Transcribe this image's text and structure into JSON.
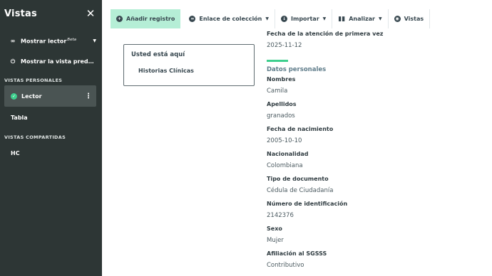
{
  "sidebar": {
    "title": "Vistas",
    "close_icon": "close-icon",
    "actions": [
      {
        "icon": "infinity-icon",
        "label": "Mostrar lector",
        "badge": "Beta"
      },
      {
        "icon": "power-icon",
        "label": "Mostrar la vista predeterminada"
      }
    ],
    "personal_section": "VISTAS PERSONALES",
    "personal_views": [
      {
        "label": "Lector",
        "active": true
      },
      {
        "label": "Tabla"
      }
    ],
    "shared_section": "VISTAS COMPARTIDAS",
    "shared_views": [
      {
        "label": "HC"
      }
    ]
  },
  "toolbar": {
    "add_record": "Añadir registro",
    "collection_link": "Enlace de colección",
    "import": "Importar",
    "analyze": "Analizar",
    "views": "Vistas"
  },
  "breadcrumb": {
    "title": "Usted está aquí",
    "item": "Historias Clínicas"
  },
  "record": {
    "top_field": {
      "label": "Fecha de la atención de primera vez",
      "value": "2025-11-12"
    },
    "section_title": "Datos personales",
    "fields": [
      {
        "label": "Nombres",
        "value": "Camila"
      },
      {
        "label": "Apellidos",
        "value": "granados"
      },
      {
        "label": "Fecha de nacimiento",
        "value": "2005-10-10"
      },
      {
        "label": "Nacionalidad",
        "value": "Colombiana"
      },
      {
        "label": "Tipo de documento",
        "value": "Cédula de Ciudadanía"
      },
      {
        "label": "Número de identificación",
        "value": "2142376"
      },
      {
        "label": "Sexo",
        "value": "Mujer"
      },
      {
        "label": "Afiliación al SGSSS",
        "value": "Contributivo"
      }
    ]
  },
  "colors": {
    "sidebar_bg": "#2d3635",
    "accent_green": "#3ecf8e",
    "primary_button_bg": "#b5eed6",
    "text_dark": "#37474f"
  }
}
